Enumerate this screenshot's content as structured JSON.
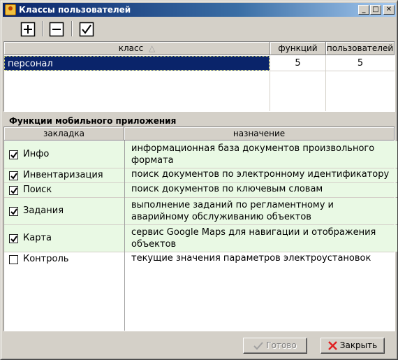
{
  "window": {
    "title": "Классы пользователей"
  },
  "toolbar": {
    "add_icon": "plus-icon",
    "remove_icon": "minus-icon",
    "apply_icon": "check-icon"
  },
  "classes_table": {
    "columns": [
      "класс",
      "функций",
      "пользователей"
    ],
    "sort_indicator": "△",
    "rows": [
      {
        "class": "персонал",
        "functions": "5",
        "users": "5"
      }
    ]
  },
  "functions_section": {
    "title": "Функции мобильного приложения",
    "columns": [
      "закладка",
      "назначение"
    ],
    "rows": [
      {
        "tab": "Инфо",
        "checked": true,
        "purpose": "информационная база документов произвольного формата"
      },
      {
        "tab": "Инвентаризация",
        "checked": true,
        "purpose": "поиск документов по электронному идентификатору"
      },
      {
        "tab": "Поиск",
        "checked": true,
        "purpose": "поиск документов по ключевым словам"
      },
      {
        "tab": "Задания",
        "checked": true,
        "purpose": "выполнение заданий по регламентному и аварийному обслуживанию объектов"
      },
      {
        "tab": "Карта",
        "checked": true,
        "purpose": "сервис Google Maps для навигации и отображения объектов"
      },
      {
        "tab": "Контроль",
        "checked": false,
        "purpose": "текущие значения параметров электроустановок"
      }
    ]
  },
  "buttons": {
    "done_label": "Готово",
    "close_label": "Закрыть"
  },
  "colors": {
    "selection": "#0a246a",
    "enabled_row": "#e9f9e4",
    "close_icon": "#e02020"
  }
}
